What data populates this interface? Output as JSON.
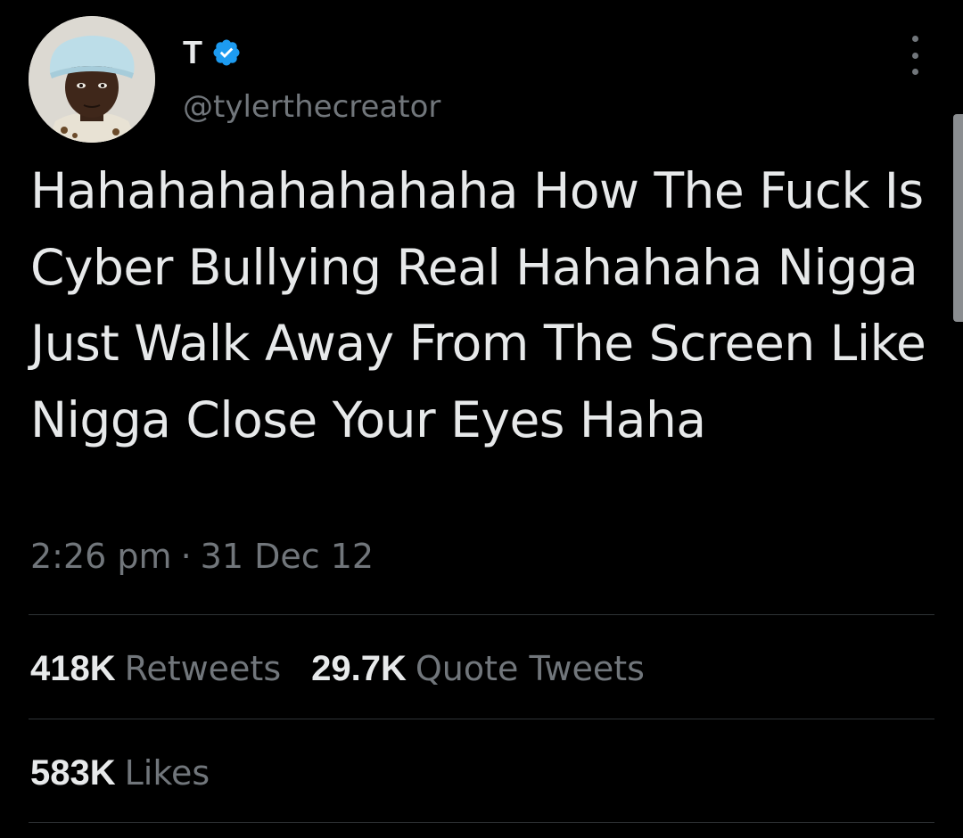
{
  "author": {
    "display_name": "T",
    "handle": "@tylerthecreator",
    "verified_icon": "verified-badge-icon",
    "avatar_icon": "profile-avatar",
    "verified_color": "#1d9bf0"
  },
  "tweet": {
    "text": "Hahahahahahahaha How The Fuck Is Cyber Bullying Real Hahahaha Nigga Just Walk Away From The Screen Like Nigga Close Your Eyes Haha",
    "time": "2:26 pm",
    "separator": "·",
    "date": "31 Dec 12"
  },
  "stats": {
    "retweets": {
      "count": "418K",
      "label": "Retweets"
    },
    "quotes": {
      "count": "29.7K",
      "label": "Quote Tweets"
    },
    "likes": {
      "count": "583K",
      "label": "Likes"
    }
  },
  "colors": {
    "background": "#000000",
    "primary_text": "#e7e9ea",
    "secondary_text": "#71767b",
    "divider": "#2f3336"
  },
  "icons": {
    "more": "more-options-icon"
  }
}
